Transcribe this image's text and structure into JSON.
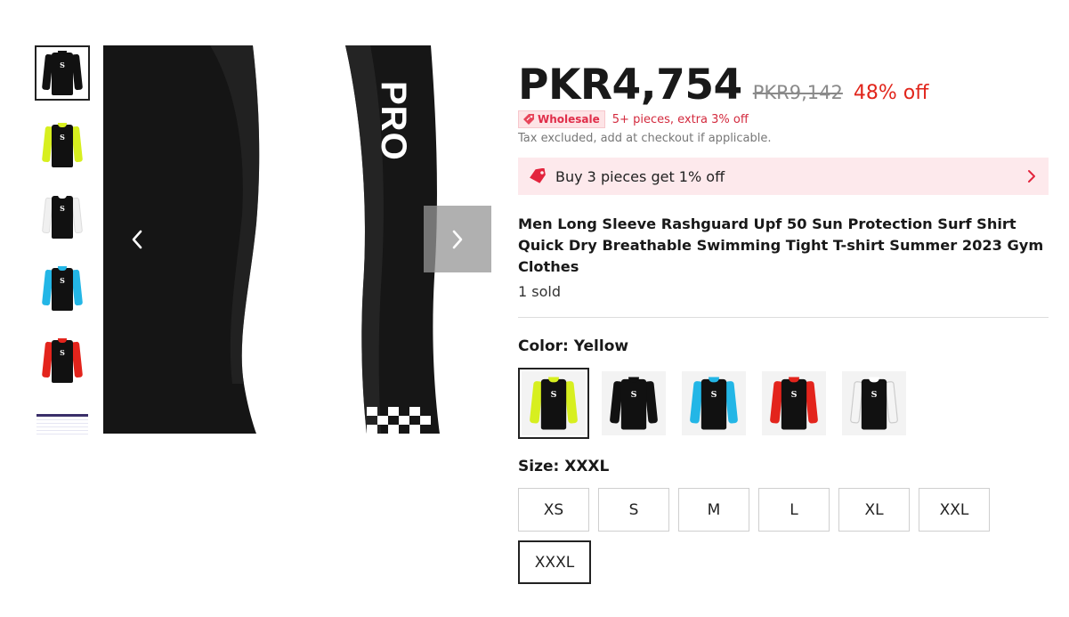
{
  "gallery": {
    "thumbnails": [
      {
        "name": "black",
        "sleeve": "#111111",
        "collar": "#111111"
      },
      {
        "name": "yellow",
        "sleeve": "#d7ef1f",
        "collar": "#d7ef1f"
      },
      {
        "name": "white",
        "sleeve": "#f2f2f2",
        "collar": "#ffffff"
      },
      {
        "name": "blue",
        "sleeve": "#23b6e6",
        "collar": "#23b6e6"
      },
      {
        "name": "red",
        "sleeve": "#e3241c",
        "collar": "#e3241c"
      },
      {
        "name": "size-chart"
      }
    ],
    "main_image_text": "PRO",
    "prev_icon": "chevron-left-icon",
    "next_icon": "chevron-right-icon"
  },
  "price": {
    "current": "PKR4,754",
    "original": "PKR9,142",
    "discount": "48% off"
  },
  "wholesale": {
    "tag_label": "Wholesale",
    "detail": "5+ pieces, extra 3% off"
  },
  "tax_note": "Tax excluded, add at checkout if applicable.",
  "promo": {
    "text": "Buy 3 pieces get 1% off",
    "icon": "price-tag-icon"
  },
  "product": {
    "title": "Men Long Sleeve Rashguard Upf 50 Sun Protection Surf Shirt Quick Dry Breathable Swimming Tight T-shirt Summer 2023 Gym Clothes",
    "sold": "1 sold"
  },
  "color": {
    "label": "Color: Yellow",
    "options": [
      {
        "name": "yellow",
        "sleeve": "#d7ef1f",
        "selected": true
      },
      {
        "name": "black",
        "sleeve": "#111111",
        "selected": false
      },
      {
        "name": "blue",
        "sleeve": "#23b6e6",
        "selected": false
      },
      {
        "name": "red",
        "sleeve": "#e3241c",
        "selected": false
      },
      {
        "name": "white",
        "sleeve": "#f2f2f2",
        "selected": false
      }
    ]
  },
  "size": {
    "label": "Size: XXXL",
    "options": [
      "XS",
      "S",
      "M",
      "L",
      "XL",
      "XXL",
      "XXXL"
    ],
    "selected": "XXXL"
  },
  "colors": {
    "accent_red": "#e1251b",
    "promo_bg": "#fde9ec"
  }
}
